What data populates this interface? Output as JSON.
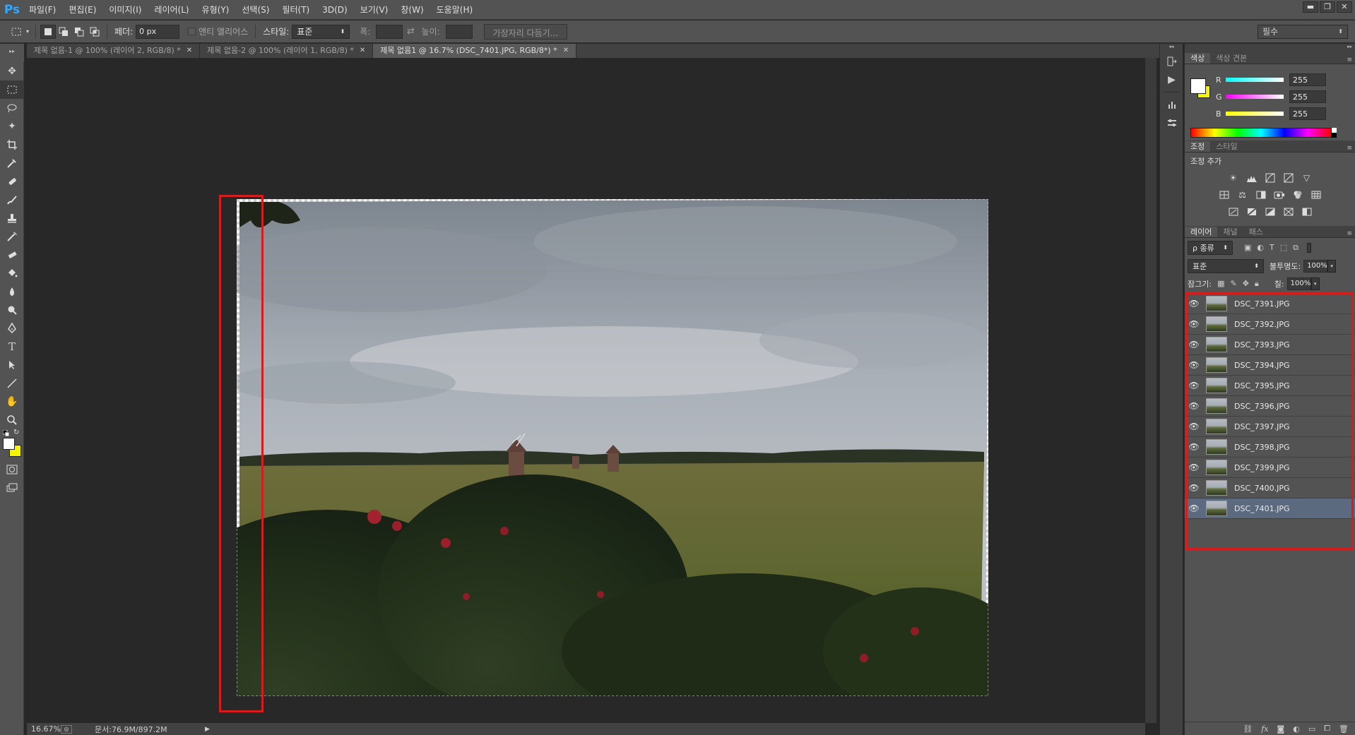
{
  "app": {
    "logo": "Ps"
  },
  "menu": [
    "파일(F)",
    "편집(E)",
    "이미지(I)",
    "레이어(L)",
    "유형(Y)",
    "선택(S)",
    "필터(T)",
    "3D(D)",
    "보기(V)",
    "창(W)",
    "도움말(H)"
  ],
  "window_controls": {
    "minimize": "▬",
    "restore": "❐",
    "close": "✕"
  },
  "options": {
    "feather_label": "페더:",
    "feather_value": "0 px",
    "antialias_label": "앤티 앨리어스",
    "style_label": "스타일:",
    "style_value": "표준",
    "width_label": "폭:",
    "height_label": "높이:",
    "refine_edge_button": "가장자리 다듬기...",
    "workspace": "필수"
  },
  "tabs": [
    {
      "label": "제목 없음-1 @ 100% (레이어 2, RGB/8) *",
      "active": false
    },
    {
      "label": "제목 없음-2 @ 100% (레이어 1, RGB/8) *",
      "active": false
    },
    {
      "label": "제목 없음1 @ 16.7% (DSC_7401.JPG, RGB/8*) *",
      "active": true
    }
  ],
  "status": {
    "zoom": "16.67%",
    "doc": "문서:76.9M/897.2M"
  },
  "color_panel": {
    "tabs": [
      "색상",
      "색상 견본"
    ],
    "channels": [
      {
        "letter": "R",
        "value": "255"
      },
      {
        "letter": "G",
        "value": "255"
      },
      {
        "letter": "B",
        "value": "255"
      }
    ],
    "fg_color": "#ffffff",
    "bg_color": "#f5f500"
  },
  "adjust_panel": {
    "tabs": [
      "조정",
      "스타일"
    ],
    "add_label": "조정 추가"
  },
  "layers_panel": {
    "tabs": [
      "레이어",
      "채널",
      "패스"
    ],
    "filter_label": "ρ 종류",
    "blend_mode": "표준",
    "opacity_label": "불투명도:",
    "opacity_value": "100%",
    "lock_label": "잠그기:",
    "fill_label": "칠:",
    "fill_value": "100%",
    "layers": [
      {
        "name": "DSC_7391.JPG",
        "selected": false
      },
      {
        "name": "DSC_7392.JPG",
        "selected": false
      },
      {
        "name": "DSC_7393.JPG",
        "selected": false
      },
      {
        "name": "DSC_7394.JPG",
        "selected": false
      },
      {
        "name": "DSC_7395.JPG",
        "selected": false
      },
      {
        "name": "DSC_7396.JPG",
        "selected": false
      },
      {
        "name": "DSC_7397.JPG",
        "selected": false
      },
      {
        "name": "DSC_7398.JPG",
        "selected": false
      },
      {
        "name": "DSC_7399.JPG",
        "selected": false
      },
      {
        "name": "DSC_7400.JPG",
        "selected": false
      },
      {
        "name": "DSC_7401.JPG",
        "selected": true
      }
    ]
  },
  "tool_icons": [
    "move-icon",
    "marquee-icon",
    "lasso-icon",
    "magic-wand-icon",
    "crop-icon",
    "eyedropper-icon",
    "healing-brush-icon",
    "brush-icon",
    "stamp-icon",
    "history-brush-icon",
    "eraser-icon",
    "paint-bucket-icon",
    "blur-icon",
    "dodge-icon",
    "pen-icon",
    "type-icon",
    "path-select-icon",
    "line-icon",
    "hand-icon",
    "zoom-icon"
  ]
}
